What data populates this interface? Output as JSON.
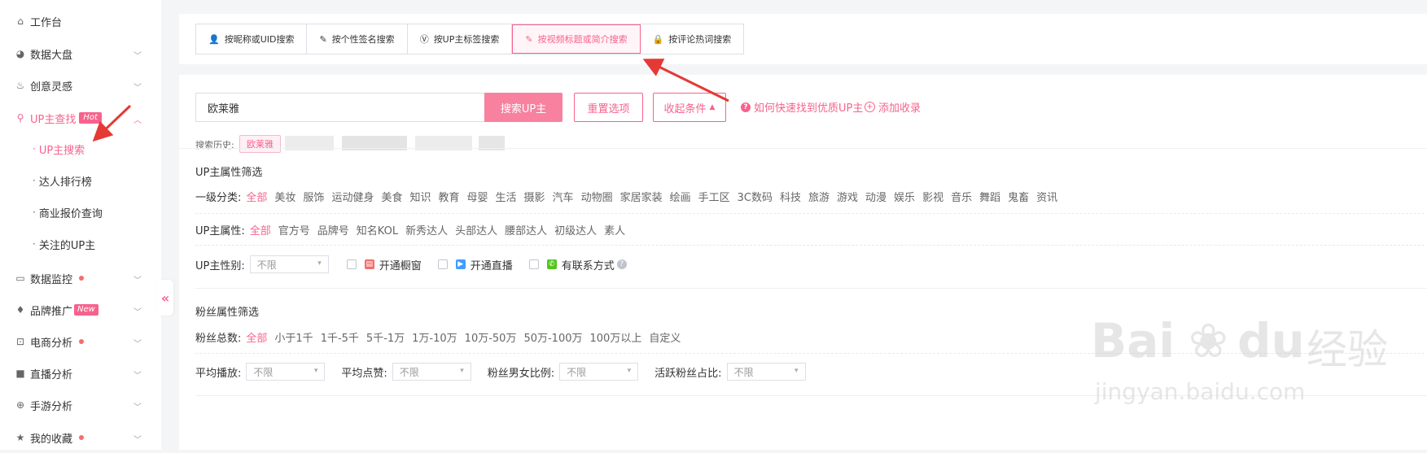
{
  "sidebar": {
    "items": [
      {
        "label": "工作台",
        "icon": "home-icon"
      },
      {
        "label": "数据大盘",
        "icon": "pie-icon"
      },
      {
        "label": "创意灵感",
        "icon": "flame-icon"
      },
      {
        "label": "UP主查找",
        "icon": "search-icon",
        "badge": "Hot"
      },
      {
        "label": "数据监控",
        "icon": "monitor-icon"
      },
      {
        "label": "品牌推广",
        "icon": "diamond-icon",
        "badge": "New"
      },
      {
        "label": "电商分析",
        "icon": "chart-icon"
      },
      {
        "label": "直播分析",
        "icon": "video-icon"
      },
      {
        "label": "手游分析",
        "icon": "gamepad-icon"
      },
      {
        "label": "我的收藏",
        "icon": "star-icon"
      }
    ],
    "sub_items": [
      "UP主搜索",
      "达人排行榜",
      "商业报价查询",
      "关注的UP主"
    ],
    "collapse_label": "«"
  },
  "tabs": [
    {
      "label": "按昵称或UID搜索",
      "icon": "user-icon"
    },
    {
      "label": "按个性签名搜索",
      "icon": "pencil-icon"
    },
    {
      "label": "按UP主标签搜索",
      "icon": "verified-icon"
    },
    {
      "label": "按视频标题或简介搜索",
      "icon": "pencil-icon",
      "active": true
    },
    {
      "label": "按评论热词搜索",
      "icon": "lock-icon"
    }
  ],
  "search": {
    "value": "欧莱雅",
    "button": "搜索UP主",
    "reset": "重置选项",
    "collapse": "收起条件",
    "help_link": "如何快速找到优质UP主",
    "add_fav": "添加收录",
    "history_label": "搜索历史:",
    "history_chip": "欧莱雅"
  },
  "up_filter": {
    "title": "UP主属性筛选",
    "category_label": "一级分类:",
    "categories": [
      "全部",
      "美妆",
      "服饰",
      "运动健身",
      "美食",
      "知识",
      "教育",
      "母婴",
      "生活",
      "摄影",
      "汽车",
      "动物圈",
      "家居家装",
      "绘画",
      "手工区",
      "3C数码",
      "科技",
      "旅游",
      "游戏",
      "动漫",
      "娱乐",
      "影视",
      "音乐",
      "舞蹈",
      "鬼畜",
      "资讯"
    ],
    "attr_label": "UP主属性:",
    "attrs": [
      "全部",
      "官方号",
      "品牌号",
      "知名KOL",
      "新秀达人",
      "头部达人",
      "腰部达人",
      "初级达人",
      "素人"
    ],
    "gender_label": "UP主性别:",
    "gender_value": "不限",
    "check1": "开通橱窗",
    "check2": "开通直播",
    "check3": "有联系方式"
  },
  "fans_filter": {
    "title": "粉丝属性筛选",
    "total_label": "粉丝总数:",
    "totals": [
      "全部",
      "小于1千",
      "1千-5千",
      "5千-1万",
      "1万-10万",
      "10万-50万",
      "50万-100万",
      "100万以上",
      "自定义"
    ],
    "avg_play_label": "平均播放:",
    "avg_like_label": "平均点赞:",
    "gender_ratio_label": "粉丝男女比例:",
    "active_ratio_label": "活跃粉丝占比:",
    "any": "不限"
  },
  "watermark": {
    "brand": "Bai",
    "brand2": "du",
    "cn": "经验",
    "url": "jingyan.baidu.com"
  },
  "colors": {
    "accent": "#f7628c",
    "arrow": "#e53935"
  }
}
